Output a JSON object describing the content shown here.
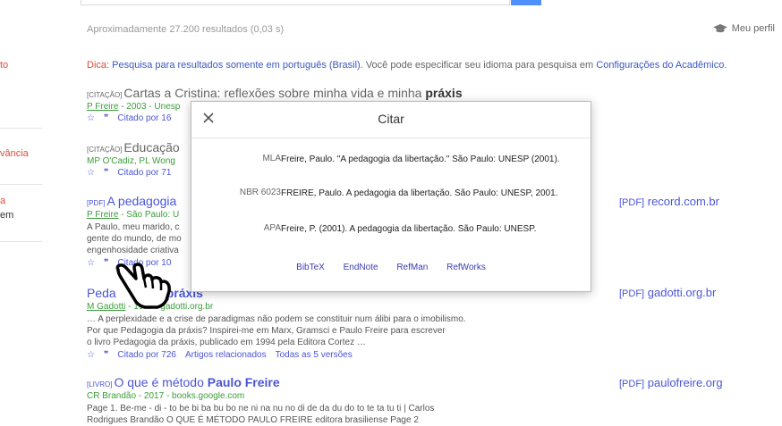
{
  "header": {
    "stats": "Aproximadamente 27.200 resultados (0,03 s)",
    "profile_label": "Meu perfil",
    "profile_icon": "graduation-cap-icon"
  },
  "left_fragments": [
    "to",
    "vância",
    "a",
    "em"
  ],
  "tip": {
    "prefix": "Dica:",
    "link1": "Pesquisa para resultados somente em português (Brasil)",
    "middle": ". Você pode especificar seu idioma para pesquisa em ",
    "link2": "Configurações do Acadêmico",
    "suffix": "."
  },
  "results": [
    {
      "tag": "[CITAÇÃO]",
      "title": "Cartas a Cristina: reflexões sobre minha vida e minha ",
      "title_bold": "práxis",
      "byline_author": "P Freire",
      "byline_rest": " - 2003 - Unesp",
      "cited": "Citado por 16"
    },
    {
      "tag": "[CITAÇÃO]",
      "title": "Educação",
      "byline": "MP O'Cadiz, PL Wong",
      "cited": "Citado por 71"
    },
    {
      "tag": "[PDF]",
      "title": "A pedagogia",
      "byline_author": "P Freire",
      "byline_rest": " - São Paulo: U",
      "snippet": [
        "A Paulo, meu marido, c",
        "gente do mundo, de mo",
        "engenhosidade criativa"
      ],
      "cited": "Citado por 10",
      "side_tag": "[PDF]",
      "side_domain": "record.com.br"
    },
    {
      "title": "Peda",
      "title_end": "práxis",
      "byline_author": "M Gadotti",
      "byline_rest": " - 19… - gadotti.org.br",
      "snippet": [
        "… A perplexidade e a crise de paradigmas não podem se constituir num álibi para o imobilismo.",
        "Por que Pedagogia da práxis? Inspirei-me em Marx, Gramsci e Paulo Freire para escrever",
        "o livro Pedagogia da práxis, publicado em 1994 pela Editora Cortez …"
      ],
      "cited": "Citado por 726",
      "related": "Artigos relacionados",
      "versions": "Todas as 5 versões",
      "side_tag": "[PDF]",
      "side_domain": "gadotti.org.br"
    },
    {
      "tag": "[LIVRO]",
      "title": "O que é método ",
      "title_bold": "Paulo Freire",
      "byline": "CR Brandão - 2017 - books.google.com",
      "snippet": [
        "Page 1. Be-me - di - to be bi ba bu bo ne ni na nu no di de da du do to te ta tu ti | Carlos",
        "Rodrigues Brandão O QUE É MÉTODO PAULO FREIRE editora brasiliense Page 2"
      ],
      "side_tag": "[PDF]",
      "side_domain": "paulofreire.org"
    }
  ],
  "modal": {
    "title": "Citar",
    "close_icon": "close-icon",
    "citations": [
      {
        "label": "MLA",
        "text": "Freire, Paulo. \"A pedagogia da libertação.\" São Paulo: UNESP (2001)."
      },
      {
        "label": "NBR 6023",
        "text": "FREIRE, Paulo. A pedagogia da libertação. São Paulo: UNESP, 2001."
      },
      {
        "label": "APA",
        "text": "Freire, P. (2001). A pedagogia da libertação. São Paulo: UNESP."
      }
    ],
    "export_links": [
      "BibTeX",
      "EndNote",
      "RefMan",
      "RefWorks"
    ]
  },
  "cursor_icon": "pointing-hand-cursor-icon"
}
